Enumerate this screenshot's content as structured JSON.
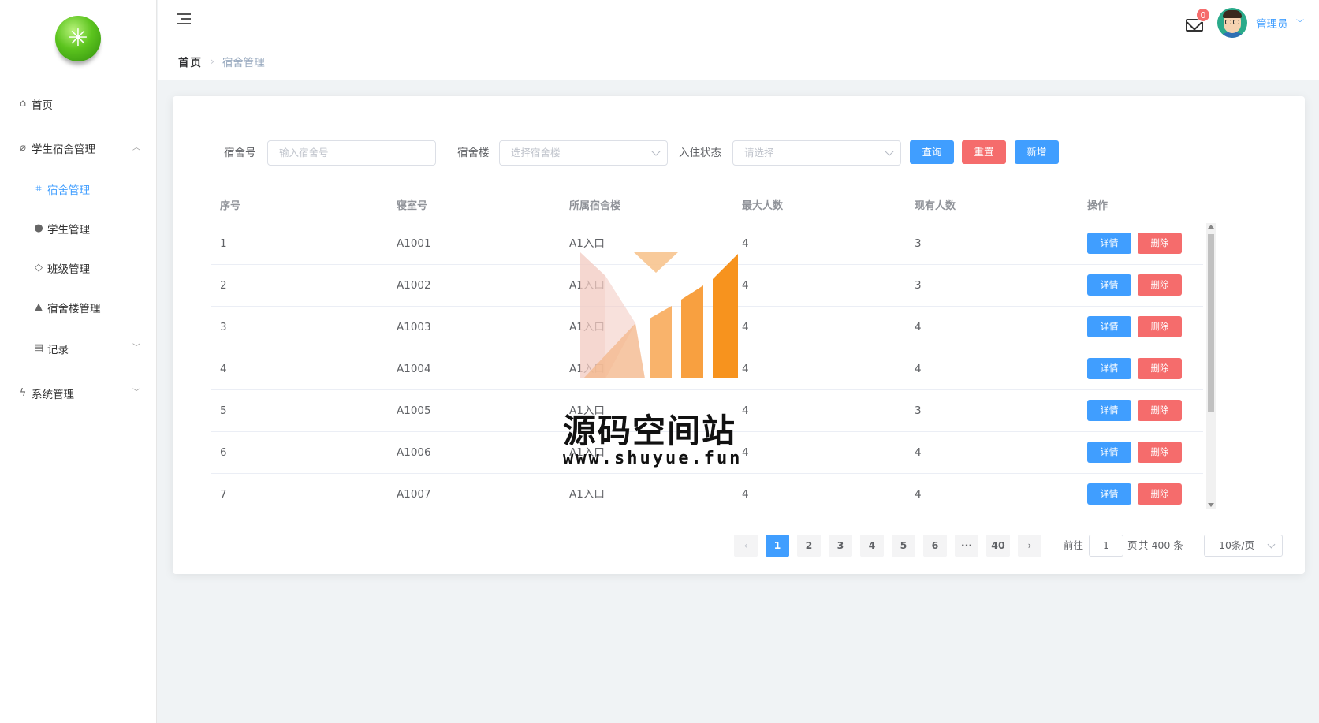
{
  "sidebar": {
    "items": [
      {
        "label": "首页",
        "icon": "home-icon"
      },
      {
        "label": "学生宿舍管理",
        "icon": "paperclip-icon",
        "expanded": true
      },
      {
        "label": "宿舍管理",
        "icon": "crop-icon",
        "active": true
      },
      {
        "label": "学生管理",
        "icon": "user-icon"
      },
      {
        "label": "班级管理",
        "icon": "graduation-cap-icon"
      },
      {
        "label": "宿舍楼管理",
        "icon": "building-icon"
      },
      {
        "label": "记录",
        "icon": "document-icon",
        "expanded": false
      },
      {
        "label": "系统管理",
        "icon": "lightning-icon",
        "expanded": false
      }
    ]
  },
  "header": {
    "breadcrumb": {
      "home": "首页",
      "current": "宿舍管理"
    },
    "notification_count": "0",
    "username": "管理员"
  },
  "search": {
    "room_label": "宿舍号",
    "room_placeholder": "输入宿舍号",
    "building_label": "宿舍楼",
    "building_placeholder": "选择宿舍楼",
    "status_label": "入住状态",
    "status_placeholder": "请选择",
    "query_label": "查询",
    "reset_label": "重置",
    "add_label": "新增"
  },
  "table": {
    "headers": [
      "序号",
      "寝室号",
      "所属宿舍楼",
      "最大人数",
      "现有人数",
      "操作"
    ],
    "detail_label": "详情",
    "delete_label": "删除",
    "rows": [
      {
        "index": "1",
        "room": "A1001",
        "building": "A1入口",
        "max": "4",
        "current": "3"
      },
      {
        "index": "2",
        "room": "A1002",
        "building": "A1入口",
        "max": "4",
        "current": "3"
      },
      {
        "index": "3",
        "room": "A1003",
        "building": "A1入口",
        "max": "4",
        "current": "4"
      },
      {
        "index": "4",
        "room": "A1004",
        "building": "A1入口",
        "max": "4",
        "current": "4"
      },
      {
        "index": "5",
        "room": "A1005",
        "building": "A1入口",
        "max": "4",
        "current": "3"
      },
      {
        "index": "6",
        "room": "A1006",
        "building": "A1入口",
        "max": "4",
        "current": "4"
      },
      {
        "index": "7",
        "room": "A1007",
        "building": "A1入口",
        "max": "4",
        "current": "4"
      }
    ]
  },
  "pagination": {
    "prev": "‹",
    "next": "›",
    "pages": [
      "1",
      "2",
      "3",
      "4",
      "5",
      "6",
      "···",
      "40"
    ],
    "current_page": "1",
    "goto_label": "前往",
    "goto_value": "1",
    "page_suffix": "页",
    "total": "共 400 条",
    "page_size": "10条/页"
  },
  "watermark": {
    "text": "源码空间站",
    "url": "www.shuyue.fun"
  },
  "colors": {
    "primary": "#409eff",
    "danger": "#f56c6c",
    "watermark_orange": "#f7931e",
    "watermark_pink": "#f2c9c0"
  }
}
